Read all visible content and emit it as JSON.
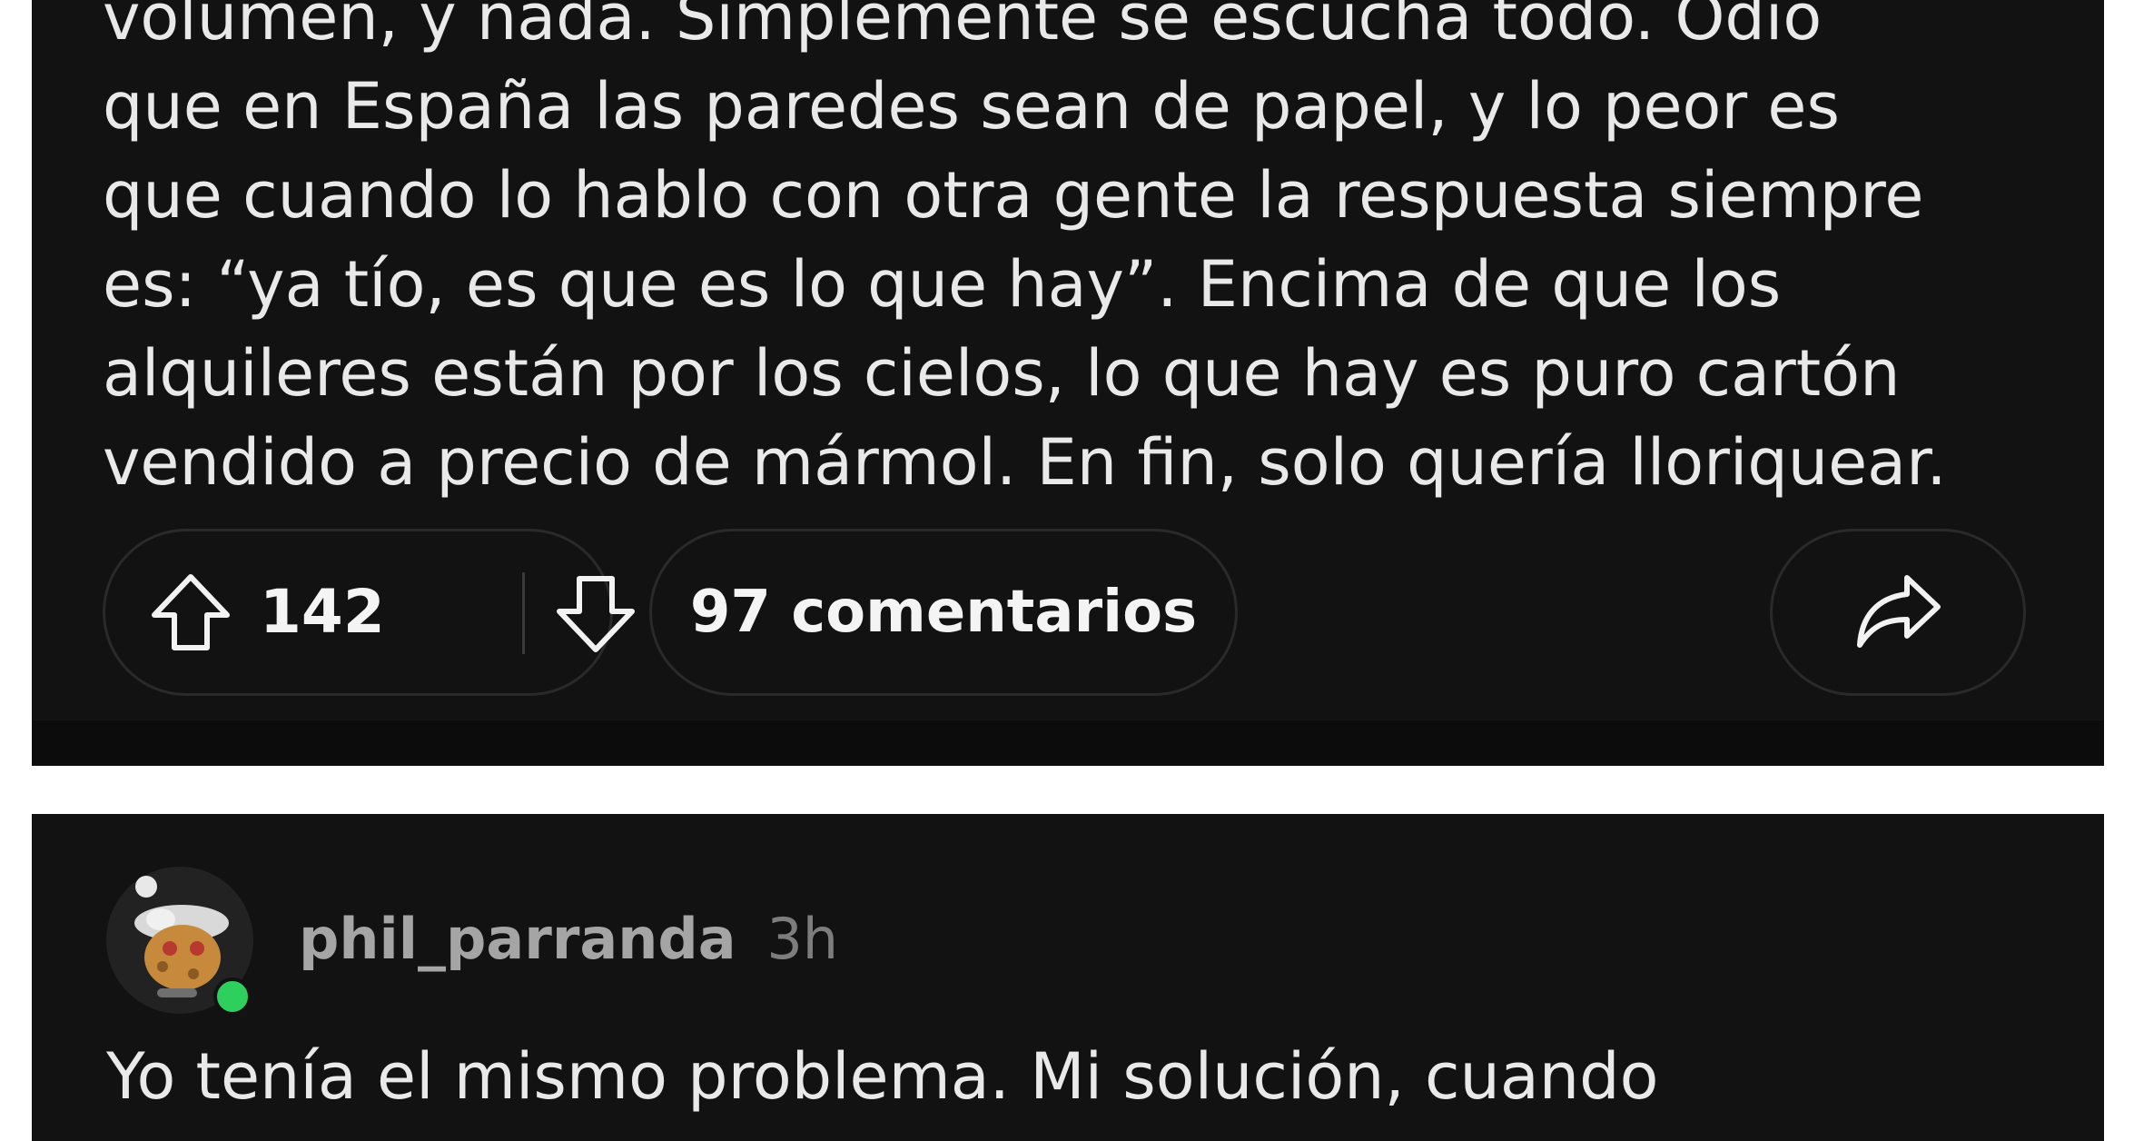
{
  "post": {
    "body_lines": [
      "volumen, y nada. Simplemente se escucha todo. Odio",
      "que en España las paredes sean de papel, y lo peor es",
      "que cuando lo hablo con otra gente la respuesta siempre",
      "es: “ya tío, es que es lo que hay”. Encima de que los",
      "alquileres están por los cielos, lo que hay es puro cartón",
      "vendido a precio de mármol. En fin, solo quería lloriquear."
    ],
    "score": "142",
    "comments_label": "97 comentarios",
    "icons": {
      "upvote": "upvote-arrow-icon",
      "downvote": "downvote-arrow-icon",
      "share": "share-arrow-icon"
    }
  },
  "comment": {
    "username": "phil_parranda",
    "time": "3h",
    "body": "Yo tenía el mismo problema. Mi solución, cuando",
    "online_color": "#2fcf5d"
  },
  "colors": {
    "card_background": "#121212",
    "page_background": "#ffffff",
    "text": "#e9e9e9",
    "muted_text": "#9a9a9a",
    "pill_border": "#2a2a2a"
  }
}
